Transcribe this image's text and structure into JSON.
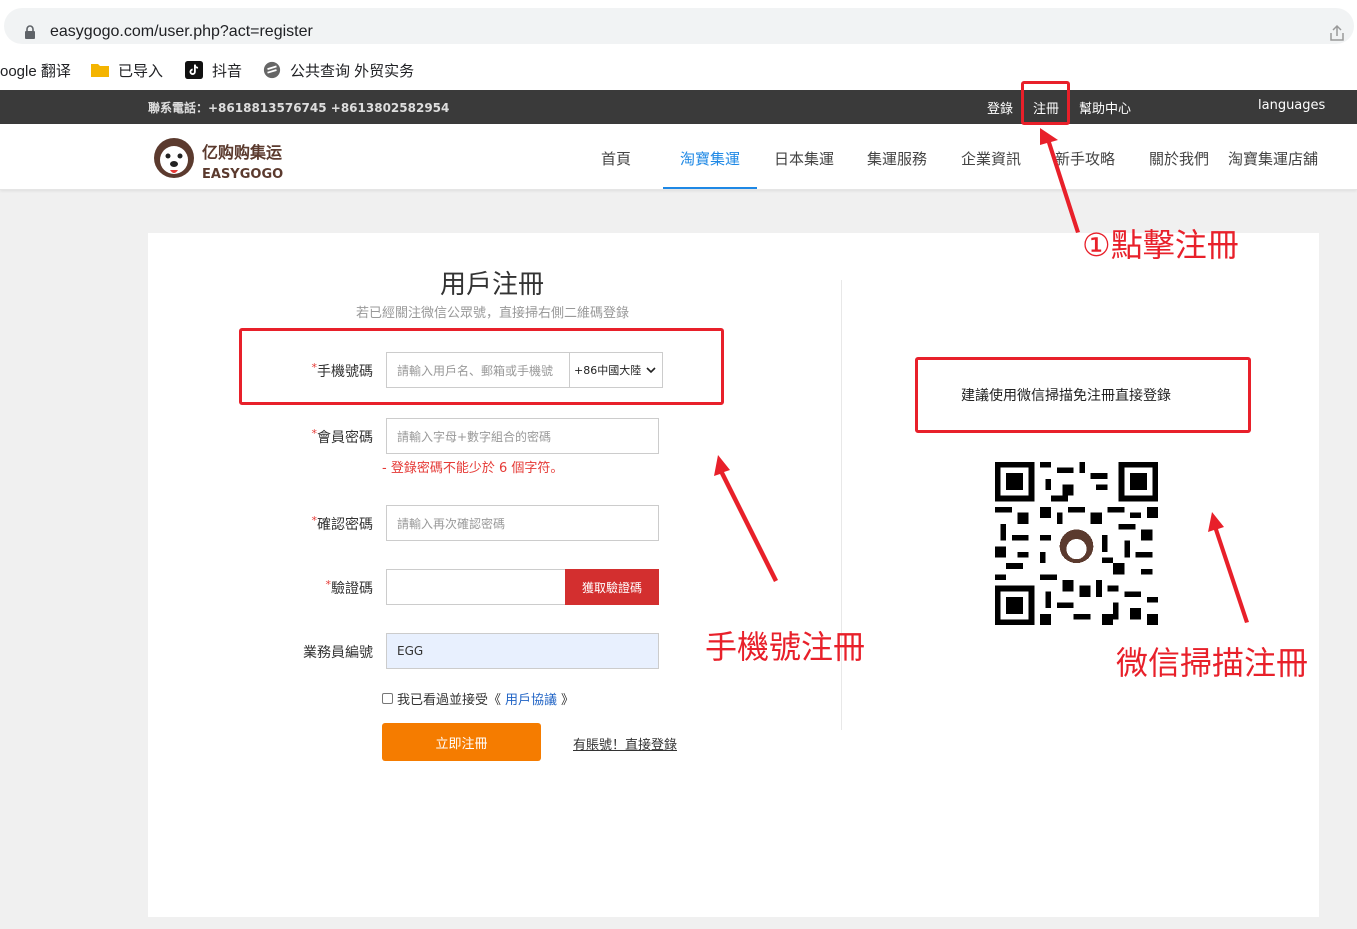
{
  "browser": {
    "url": "easygogo.com/user.php?act=register",
    "bookmarks": [
      {
        "label": "oogle 翻译",
        "icon": "translate-icon"
      },
      {
        "label": "已导入",
        "icon": "folder-icon"
      },
      {
        "label": "抖音",
        "icon": "tiktok-icon"
      },
      {
        "label": "公共查询 外贸实务",
        "icon": "e-logo-icon"
      }
    ]
  },
  "topbar": {
    "phone": "聯系電話：+8618813576745 +8613802582954",
    "login": "登錄",
    "register": "注冊",
    "help": "幫助中心",
    "languages": "languages"
  },
  "nav": {
    "items": [
      "首頁",
      "淘寶集運",
      "日本集運",
      "集運服務",
      "企業資訊",
      "新手攻略",
      "關於我們",
      "淘寶集運店舖"
    ],
    "active_index": 1
  },
  "form": {
    "title": "用戶注冊",
    "subtitle": "若已經關注微信公眾號，直接掃右側二維碼登錄",
    "phone_label": "手機號碼",
    "phone_placeholder": "請輸入用戶名、郵箱或手機號",
    "country_code": "+86中國大陸",
    "password_label": "會員密碼",
    "password_placeholder": "請輸入字母+數字組合的密碼",
    "password_error": "- 登錄密碼不能少於 6 個字符。",
    "confirm_label": "確認密碼",
    "confirm_placeholder": "請輸入再次確認密碼",
    "code_label": "驗證碼",
    "code_button": "獲取驗證碼",
    "agent_label": "業務員編號",
    "agent_value": "EGG",
    "agree_prefix": "我已看過並接受《",
    "agree_link": "用戶協議",
    "agree_suffix": "》",
    "submit": "立即注冊",
    "login_link": "有賬號！直接登錄"
  },
  "wechat": {
    "tip": "建議使用微信掃描免注冊直接登錄"
  },
  "annotations": {
    "step1": "①點擊注冊",
    "phone_reg": "手機號注冊",
    "wechat_reg": "微信掃描注冊"
  },
  "colors": {
    "annotation_red": "#e8202a",
    "accent_blue": "#1e88e5",
    "submit_orange": "#f57c00",
    "sms_red": "#d32f2f"
  }
}
